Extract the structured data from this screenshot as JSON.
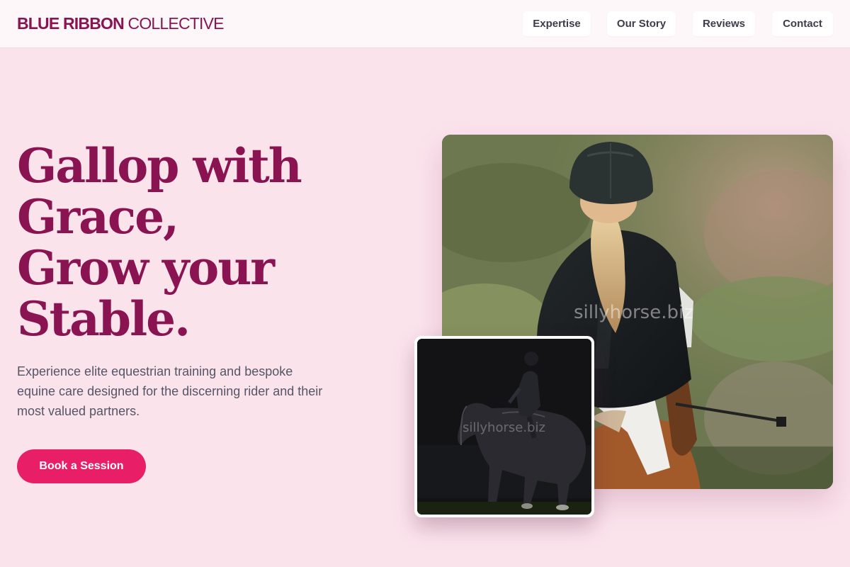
{
  "brand": {
    "name_bold": "BLUE RIBBON",
    "name_light": "COLLECTIVE"
  },
  "nav": [
    {
      "label": "Expertise"
    },
    {
      "label": "Our Story"
    },
    {
      "label": "Reviews"
    },
    {
      "label": "Contact"
    }
  ],
  "hero": {
    "headline_lines": [
      "Gallop with",
      "Grace,",
      "Grow your",
      "Stable."
    ],
    "subtext": "Experience elite equestrian training and bespoke equine care designed for the discerning rider and their most valued partners.",
    "cta_label": "Book a Session"
  },
  "images": {
    "main_watermark": "sillyhorse.biz",
    "small_watermark": "sillyhorse.biz"
  },
  "colors": {
    "background": "#fbe3ec",
    "brand": "#8a1452",
    "accent": "#e81f67",
    "header_bg": "#fef7f9"
  }
}
